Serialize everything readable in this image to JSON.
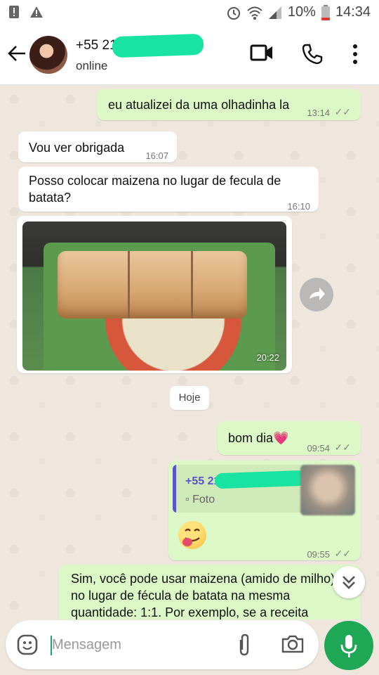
{
  "status_bar": {
    "battery_percent": "10%",
    "clock": "14:34",
    "icons": [
      "notification-icon",
      "warning-icon",
      "alarm-icon",
      "wifi-icon",
      "signal-icon",
      "battery-icon"
    ]
  },
  "header": {
    "contact_name_visible": "+55 21",
    "contact_status": "online",
    "icons": [
      "back-arrow-icon",
      "video-call-icon",
      "voice-call-icon",
      "more-options-icon"
    ]
  },
  "messages": [
    {
      "direction": "outgoing",
      "text": "eu atualizei da uma olhadinha la",
      "time": "13:14",
      "read": true
    },
    {
      "direction": "incoming",
      "text": "Vou ver obrigada",
      "time": "16:07"
    },
    {
      "direction": "incoming",
      "text": "Posso colocar maizena no lugar de fecula de batata?",
      "time": "16:10"
    },
    {
      "direction": "incoming",
      "type": "image",
      "time": "20:22"
    },
    {
      "direction": "outgoing",
      "text": "bom dia💗",
      "time": "09:54",
      "read": true
    },
    {
      "direction": "outgoing",
      "type": "reply",
      "quoted_sender": "+55 21",
      "quoted_type": "Foto",
      "text": "😋",
      "time": "09:55",
      "read": true
    },
    {
      "direction": "incoming",
      "text": "Sim, você pode usar maizena (amido de milho) no lugar de fécula de batata na mesma quantidade: 1:1. Por exemplo, se a receita"
    }
  ],
  "date_separator": "Hoje",
  "composer": {
    "placeholder": "Mensagem",
    "icons": [
      "emoji-icon",
      "attach-icon",
      "camera-icon",
      "mic-icon"
    ]
  },
  "colors": {
    "outgoing_bubble": "#dcf8c6",
    "incoming_bubble": "#ffffff",
    "accent_green": "#1ea855",
    "chat_background": "#efe7dd"
  }
}
